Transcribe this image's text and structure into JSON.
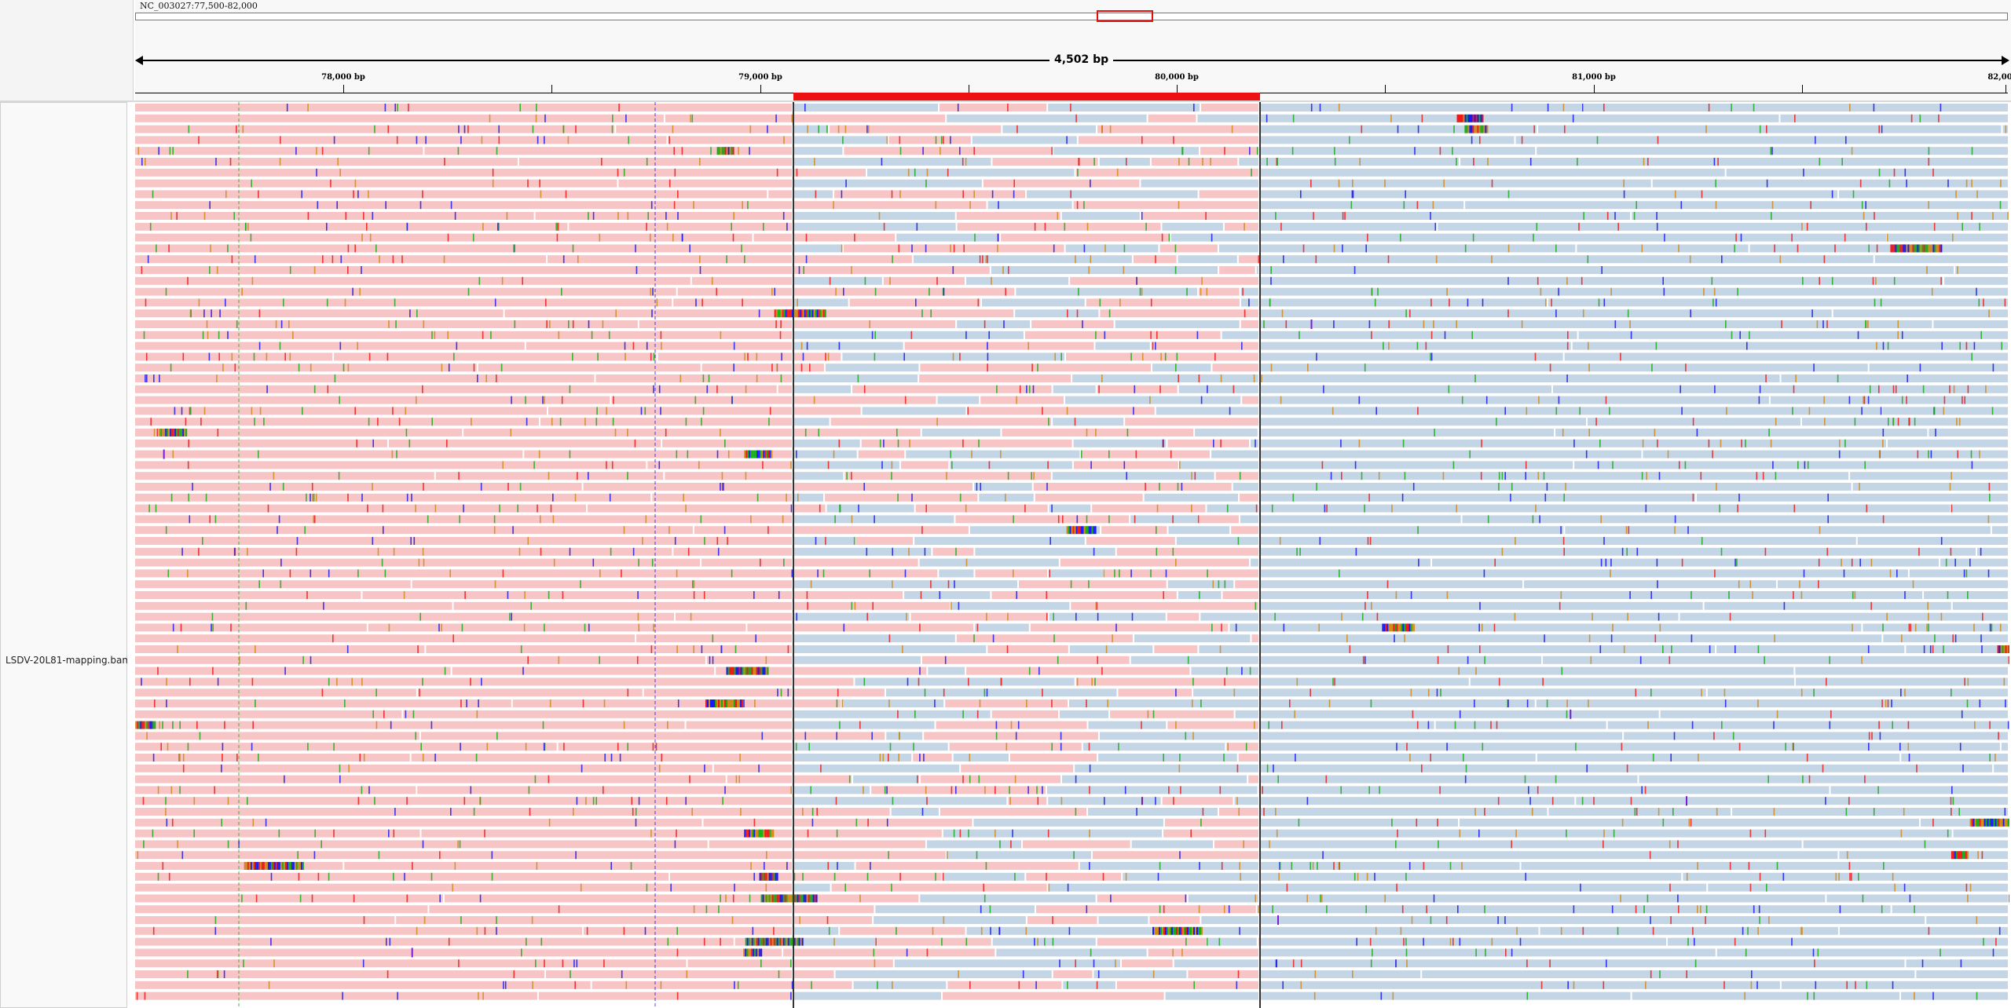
{
  "locus": "NC_003027:77,500-82,000",
  "span_label": "4,502 bp",
  "ruler_ticks": [
    "78,000 bp",
    "79,000 bp",
    "80,000 bp",
    "81,000 bp",
    "82,00"
  ],
  "track": {
    "name": "LSDV-20L81-mapping.bam"
  },
  "colors": {
    "read_pink": "#f7c5c5",
    "read_blue": "#c4d5e6",
    "roi_red": "#ee1111",
    "mismatch_A": "#1aaa1a",
    "mismatch_C": "#1a1aee",
    "mismatch_G": "#d08a1a",
    "mismatch_T": "#ee1a1a",
    "insertion": "#7a1adf"
  }
}
